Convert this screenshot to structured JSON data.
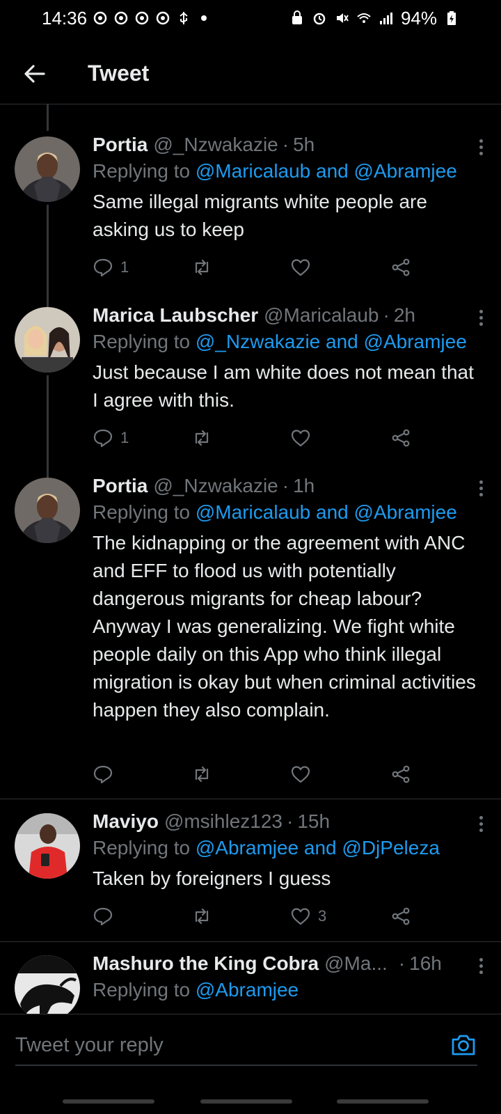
{
  "status_bar": {
    "time": "14:36",
    "battery": "94%"
  },
  "header": {
    "title": "Tweet"
  },
  "tweets": [
    {
      "name": "Portia",
      "handle": "@_Nzwakazie",
      "time": "5h",
      "replying_prefix": "Replying to ",
      "replying_mentions": "@Maricalaub and @Abramjee",
      "text": "Same illegal migrants white people are asking us to keep",
      "reply_count": "1",
      "retweet_count": "",
      "like_count": ""
    },
    {
      "name": "Marica Laubscher",
      "handle": "@Maricalaub",
      "time": "2h",
      "replying_prefix": "Replying to ",
      "replying_mentions": "@_Nzwakazie and @Abramjee",
      "text": "Just because I am white does not mean that I agree with this.",
      "reply_count": "1",
      "retweet_count": "",
      "like_count": ""
    },
    {
      "name": "Portia",
      "handle": "@_Nzwakazie",
      "time": "1h",
      "replying_prefix": "Replying to ",
      "replying_mentions": "@Maricalaub and @Abramjee",
      "text": "The kidnapping or the agreement with ANC and EFF to flood us with potentially dangerous migrants for cheap labour? Anyway I was generalizing. We fight white people daily on this App who think illegal migration is okay but when criminal activities happen they also complain.",
      "reply_count": "",
      "retweet_count": "",
      "like_count": ""
    },
    {
      "name": "Maviyo",
      "handle": "@msihlez123",
      "time": "15h",
      "replying_prefix": "Replying to ",
      "replying_mentions": "@Abramjee and @DjPeleza",
      "text": "Taken by foreigners I guess",
      "reply_count": "",
      "retweet_count": "",
      "like_count": "3"
    },
    {
      "name": "Mashuro the King Cobra",
      "handle": "@Ma...",
      "time": "16h",
      "replying_prefix": "Replying to ",
      "replying_mentions": "@Abramjee",
      "text": "",
      "reply_count": "",
      "retweet_count": "",
      "like_count": ""
    }
  ],
  "compose": {
    "placeholder": "Tweet your reply"
  },
  "colors": {
    "accent": "#1d9bf0",
    "muted": "#71767b",
    "text": "#e7e9ea",
    "background": "#000000"
  }
}
